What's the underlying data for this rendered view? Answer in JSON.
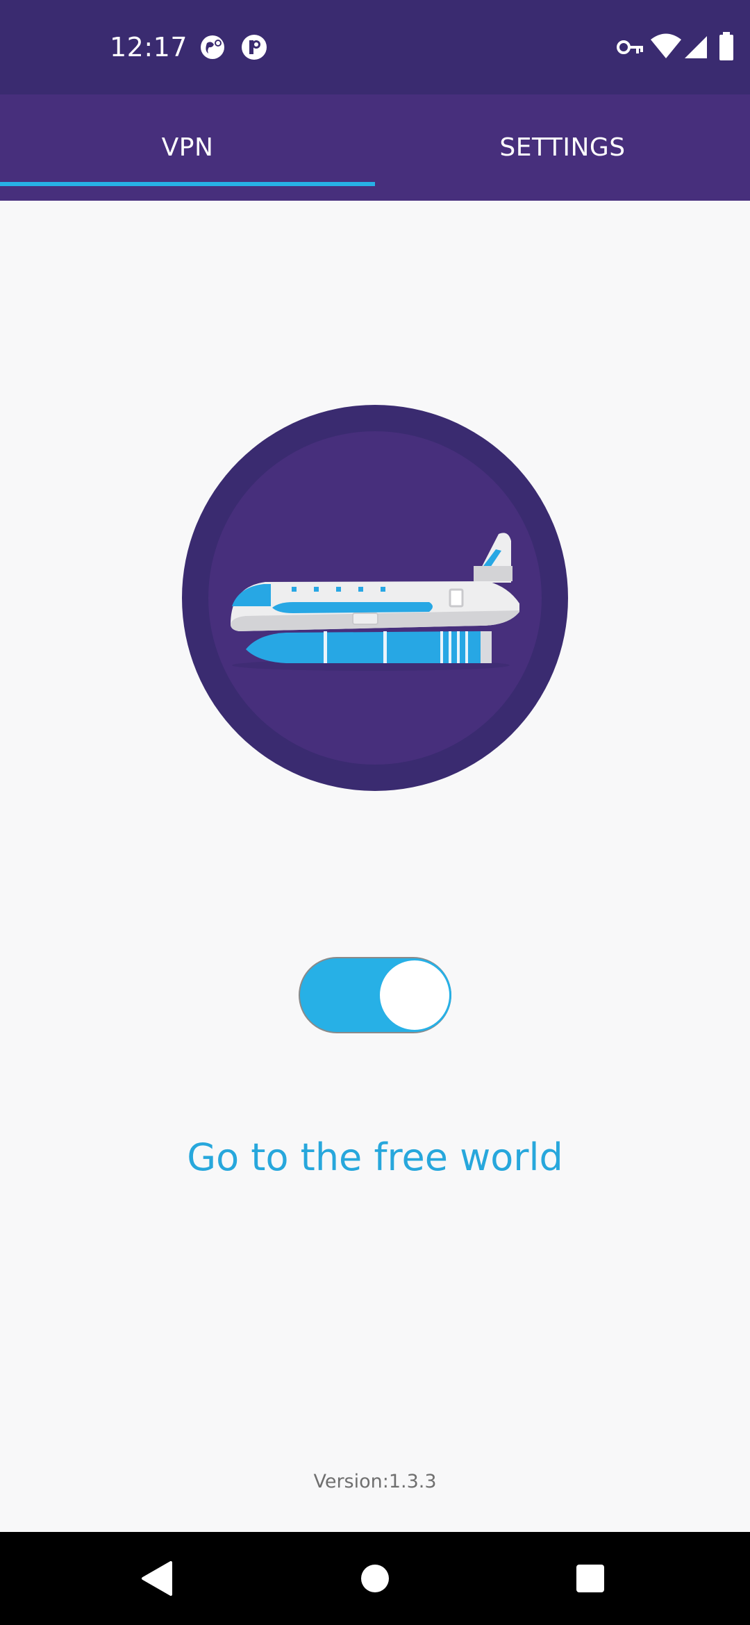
{
  "status_bar": {
    "time": "12:17",
    "left_icons": [
      "globe-location-icon",
      "notification-badge-icon"
    ],
    "right_icons": [
      "vpn-key-icon",
      "wifi-icon",
      "signal-icon",
      "battery-icon"
    ]
  },
  "tabs": [
    {
      "label": "VPN",
      "selected": true
    },
    {
      "label": "SETTINGS",
      "selected": false
    }
  ],
  "hero": {
    "icon": "airplane-illustration-icon"
  },
  "vpn_toggle": {
    "on": true
  },
  "tagline": "Go to the free world",
  "version": "Version:1.3.3",
  "colors": {
    "status_bar": "#3a2b70",
    "tab_bar": "#472f7c",
    "accent": "#27b0e6",
    "background": "#f8f8f9",
    "circle_outer": "#3a2b70",
    "circle_inner": "#472f7c"
  },
  "nav_bar": {
    "icons": [
      "back-icon",
      "home-icon",
      "recents-icon"
    ]
  }
}
